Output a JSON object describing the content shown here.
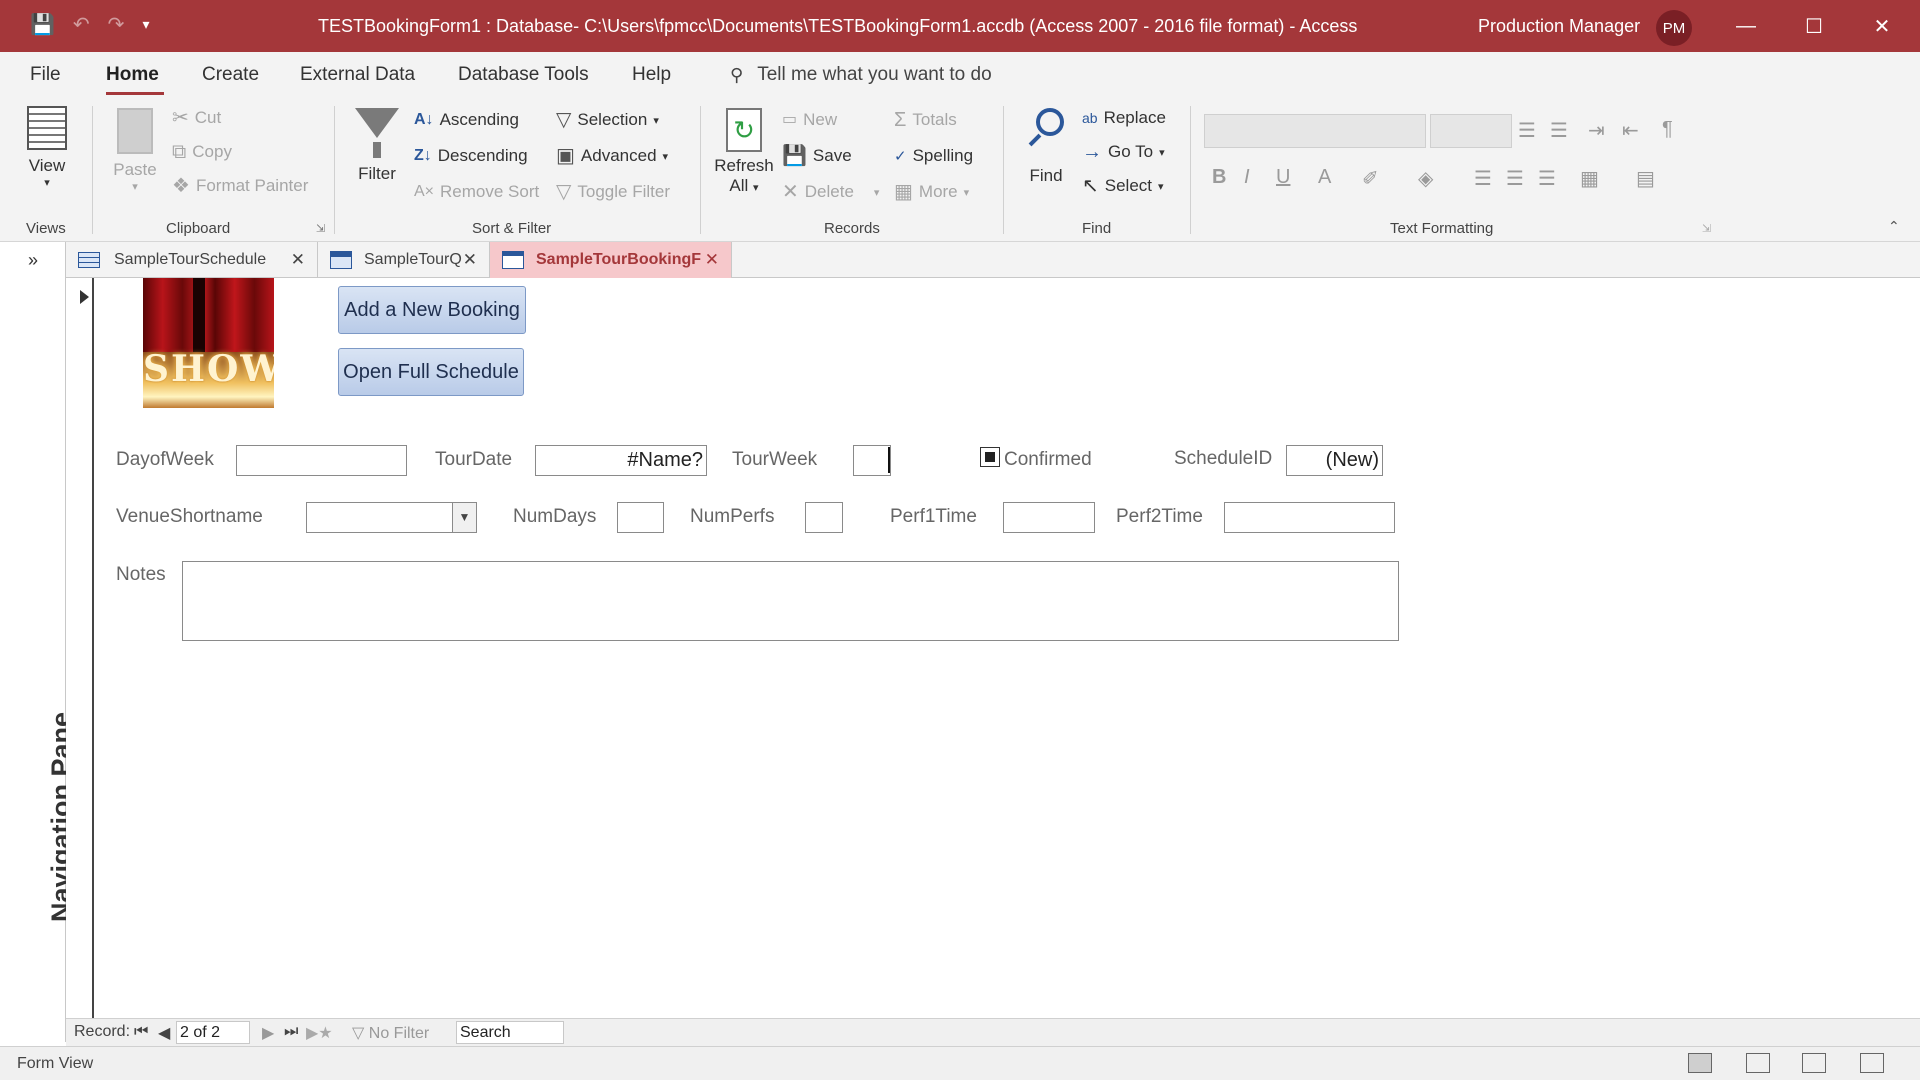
{
  "titlebar": {
    "title": "TESTBookingForm1 : Database- C:\\Users\\fpmcc\\Documents\\TESTBookingForm1.accdb (Access 2007 - 2016 file format)  -  Access",
    "user": "Production Manager",
    "avatar": "PM",
    "icons": [
      "save-icon",
      "undo-icon",
      "redo-icon",
      "customize-qat-icon",
      "minimize-icon",
      "maximize-icon",
      "close-icon"
    ]
  },
  "menu": {
    "tabs": [
      "File",
      "Home",
      "Create",
      "External Data",
      "Database Tools",
      "Help"
    ],
    "active": "Home",
    "tellme": "Tell me what you want to do"
  },
  "ribbon": {
    "views": {
      "view": "View",
      "label": "Views"
    },
    "clipboard": {
      "paste": "Paste",
      "cut": "Cut",
      "copy": "Copy",
      "format_painter": "Format Painter",
      "label": "Clipboard"
    },
    "sort_filter": {
      "filter": "Filter",
      "ascending": "Ascending",
      "descending": "Descending",
      "remove_sort": "Remove Sort",
      "selection": "Selection",
      "advanced": "Advanced",
      "toggle_filter": "Toggle Filter",
      "label": "Sort & Filter"
    },
    "records": {
      "refresh": "Refresh",
      "refresh_all": "All",
      "new": "New",
      "save": "Save",
      "delete": "Delete",
      "totals": "Totals",
      "spelling": "Spelling",
      "more": "More",
      "label": "Records"
    },
    "find": {
      "find": "Find",
      "replace": "Replace",
      "goto": "Go To",
      "select": "Select",
      "label": "Find"
    },
    "text_formatting": {
      "label": "Text Formatting",
      "bold": "B",
      "italic": "I",
      "underline": "U",
      "font_color": "A"
    }
  },
  "navpane": {
    "label": "Navigation Pane",
    "toggle": "»"
  },
  "doctabs": [
    {
      "label": "SampleTourSchedule",
      "active": false
    },
    {
      "label": "SampleTourQ",
      "active": false
    },
    {
      "label": "SampleTourBookingF",
      "active": true
    }
  ],
  "form": {
    "image_text": "SHOW",
    "buttons": {
      "add_booking": "Add a New Booking",
      "open_schedule": "Open Full Schedule"
    },
    "fields": {
      "dayofweek": {
        "label": "DayofWeek",
        "value": ""
      },
      "tourdate": {
        "label": "TourDate",
        "value": "#Name?"
      },
      "tourweek": {
        "label": "TourWeek",
        "value": ""
      },
      "confirmed": {
        "label": "Confirmed",
        "checked": true
      },
      "scheduleid": {
        "label": "ScheduleID",
        "value": "(New)"
      },
      "venueshortname": {
        "label": "VenueShortname",
        "value": ""
      },
      "numdays": {
        "label": "NumDays",
        "value": ""
      },
      "numperfs": {
        "label": "NumPerfs",
        "value": ""
      },
      "perf1time": {
        "label": "Perf1Time",
        "value": ""
      },
      "perf2time": {
        "label": "Perf2Time",
        "value": ""
      },
      "notes": {
        "label": "Notes",
        "value": ""
      }
    }
  },
  "recnav": {
    "label": "Record:",
    "current": "2 of 2",
    "filter": "No Filter",
    "search": "Search"
  },
  "status": {
    "text": "Form View"
  },
  "colors": {
    "accent": "#a4373a",
    "tab_active_bg": "#f6c8cb",
    "button_bg": "#c5d5ee"
  }
}
